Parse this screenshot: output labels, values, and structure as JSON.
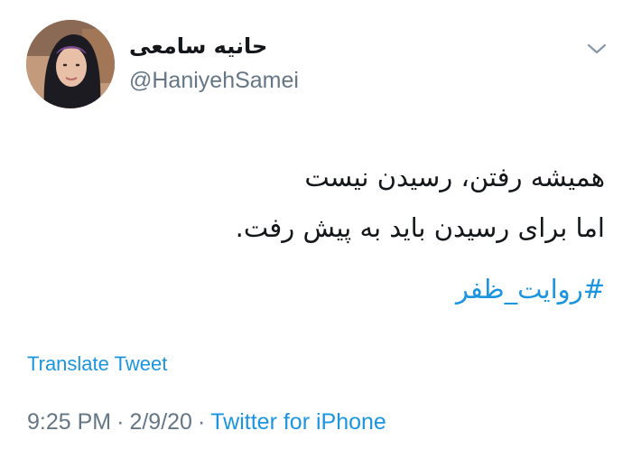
{
  "author": {
    "display_name": "حانیه سامعی",
    "handle": "@HaniyehSamei"
  },
  "tweet": {
    "line1": "همیشه رفتن، رسیدن نیست",
    "line2": "اما برای رسیدن باید به پیش رفت.",
    "hashtag": "#روایت_ظفر"
  },
  "actions": {
    "translate_label": "Translate Tweet",
    "menu_icon": "chevron-down-icon"
  },
  "meta": {
    "time": "9:25 PM",
    "separator": "·",
    "date": "2/9/20",
    "source": "Twitter for iPhone"
  },
  "colors": {
    "link": "#1b95e0",
    "secondary_text": "#657786",
    "primary_text": "#14171a"
  }
}
